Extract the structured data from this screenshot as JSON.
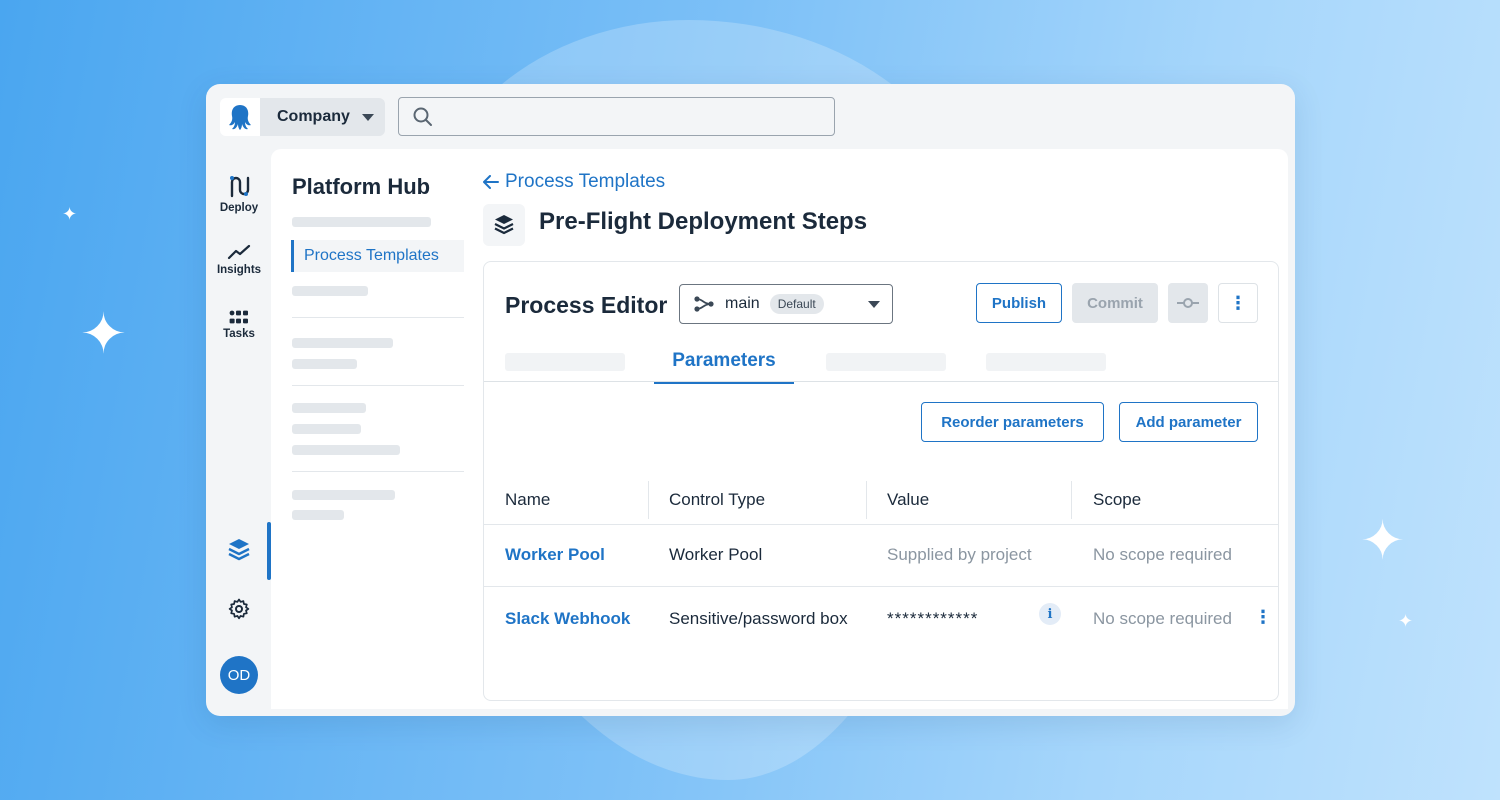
{
  "app": {
    "company": "Company",
    "search_placeholder": "",
    "brand_color": "#1f74c6"
  },
  "rail": {
    "items": [
      {
        "label": "Deploy",
        "icon": "deploy-icon"
      },
      {
        "label": "Insights",
        "icon": "insights-icon"
      },
      {
        "label": "Tasks",
        "icon": "tasks-icon"
      }
    ],
    "bottom_icons": [
      "layers-icon",
      "gear-icon"
    ],
    "avatar": "OD"
  },
  "sidebar": {
    "title": "Platform Hub",
    "active_item": "Process Templates"
  },
  "page": {
    "back_link": "Process Templates",
    "title": "Pre-Flight Deployment Steps"
  },
  "editor": {
    "title": "Process Editor",
    "branch": "main",
    "branch_badge": "Default",
    "publish": "Publish",
    "commit": "Commit",
    "active_tab": "Parameters",
    "reorder": "Reorder parameters",
    "add": "Add parameter"
  },
  "table": {
    "headers": [
      "Name",
      "Control Type",
      "Value",
      "Scope"
    ],
    "rows": [
      {
        "name": "Worker Pool",
        "control": "Worker Pool",
        "value": "Supplied by project",
        "scope": "No scope required"
      },
      {
        "name": "Slack Webhook",
        "control": "Sensitive/password box",
        "value": "************",
        "scope": "No scope required"
      }
    ]
  }
}
